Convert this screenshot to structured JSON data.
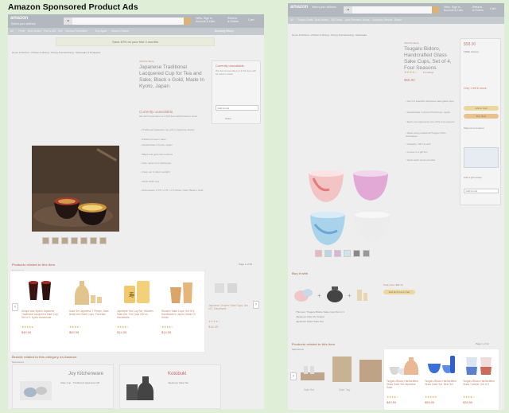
{
  "heading": "Amazon Sponsored Product Ads",
  "left": {
    "nav": {
      "logo": "amazon",
      "deliver": "Hello",
      "deliver2": "Select your address",
      "dept": "All",
      "account": "Hello, Sign in",
      "account2": "Account & Lists",
      "orders": "Returns",
      "orders2": "& Orders",
      "cart": "Cart"
    },
    "subnav": [
      "All",
      "Prime",
      "Best Sellers",
      "Find a Gift",
      "Sell",
      "Outdoor Recreation",
      "Buy Again",
      "Amazon Basics",
      "Browsing History"
    ],
    "promo": "Save 40% on your first 4 months",
    "breadcrumb": "Home & Kitchen › Kitchen & Dining › Dining & Entertaining › Glassware & Drinkware",
    "store": "Visit the Store",
    "title": "Japanese Traditional Lacquered Cup for Tea and Sake, Black x Gold, Made In Kyoto, Japan",
    "availability": "Currently unavailable.",
    "availability2": "We don't know when or if this item will be back in stock.",
    "bullets": [
      "• Traditional Japanese cup with a Japanese design",
      "• Perfect for tea or sake",
      "• Handcrafted in Kyoto, Japan",
      "• Black and gold color scheme",
      "• Size: about 7cm (Diameter)",
      "• Keep out of direct sunlight",
      "• Hand wash only",
      "• Dimensions: 2.75 x 2.75 x 1.5 inches; Color: Black x Gold"
    ],
    "buybox": {
      "title": "Currently unavailable.",
      "text": "We don't know when or if this item will be back in stock.",
      "list_label": "Add to List",
      "share": "Share"
    },
    "sponsored_title": "Products related to this item",
    "sponsored_label": "Sponsored",
    "page": "Page 1 of 50",
    "cards": [
      {
        "title": "Unique and Stylish Japanese Traditional Lacquered Sake Cup, Set of 2, Kyoto Handmade",
        "price": "$49.90",
        "rating": "★★★★★"
      },
      {
        "title": "Sake Set Japanese 7 Pieces, Sake Bottle and Sake Cups, Porcelain",
        "price": "$40.95",
        "rating": "★★★★☆"
      },
      {
        "title": "Japanese Tea Cup Set, Wooden Sake Set, Tea Cups 200 ml, Handmade",
        "price": "$14.95",
        "rating": "★★★★☆"
      },
      {
        "title": "Wooden Sake Cups, Set of 5, Handmade in Japan, Made Of Hinoki",
        "price": "$14.95",
        "rating": "★★★★☆"
      },
      {
        "title": "Japanese Ceramic Sake Cups, Set of 2, Handmade",
        "price": "$16.49",
        "rating": "★★★★☆"
      }
    ],
    "brands_title": "Brands related to this category on Amazon",
    "brands_sponsored": "Sponsored",
    "brands": [
      {
        "name": "Joy Kitchenware",
        "tagline": "Sake Cup - Traditional Japanese Gift"
      },
      {
        "name": "Kotobuki",
        "tagline": "Japanese Sake Set"
      }
    ]
  },
  "right": {
    "nav": {
      "logo": "amazon",
      "deliver": "Hello",
      "deliver2": "Select your address",
      "dept": "All",
      "account": "Hello, Sign in",
      "account2": "Account & Lists",
      "orders": "Returns",
      "orders2": "& Orders",
      "cart": "Cart"
    },
    "subnav": [
      "All",
      "Today's Deals",
      "Best Sellers",
      "Gift Cards",
      "New Releases",
      "Home",
      "Customer Service",
      "Books"
    ],
    "breadcrumb": "Home & Kitchen › Kitchen & Dining › Dining & Entertaining › Glassware",
    "store": "Visit the Store",
    "title": "Tsugaru Bidoro, Handcrafted Glass Sake Cups, Set of 4, Four Seasons",
    "rating_count": "15 ratings",
    "price": "$58.90",
    "bullets": [
      "• Set of 4 beautiful Japanese sake glass cups",
      "• Handcrafted in Aomori Prefecture, Japan",
      "• Each cup represents one of the four seasons",
      "• Made using traditional Tsugaru Vidro techniques",
      "• Capacity: 100 ml each",
      "• Comes in a gift box",
      "• Hand wash recommended"
    ],
    "buybox": {
      "price": "$58.90",
      "delivery": "FREE delivery",
      "stock": "Only 1 left in stock",
      "add_to_cart": "Add to Cart",
      "buy_now": "Buy Now",
      "ships_from": "Ships from Amazon",
      "gift": "Add a gift receipt",
      "list": "Add to List"
    },
    "bought_title": "Buy it with",
    "bought_price": "Total price: $98.40",
    "bought_button": "Add all three to Cart",
    "bought_items": [
      "This item: Tsugaru Bidoro Sake Cups Set of 4",
      "Japanese Cast Iron Teapot",
      "Japanese Glass Sake Set"
    ],
    "sponsored_title": "Products related to this item",
    "sponsored_label": "Sponsored",
    "page": "Page 1 of 11",
    "cards": [
      {
        "title": "Tsugaru Bidoro Handcrafted Glass Sake Set Japanese Sake",
        "price": "$49.90",
        "rating": "★★★★☆"
      },
      {
        "title": "Tsugaru Bidoro Handcrafted Glass Sake Set, Blue Set",
        "price": "$59.90",
        "rating": "★★★★★"
      },
      {
        "title": "Tsugaru Bidoro Handcrafted Glass Tumbler, Set of 2",
        "price": "$39.90",
        "rating": "★★★★☆"
      }
    ]
  }
}
